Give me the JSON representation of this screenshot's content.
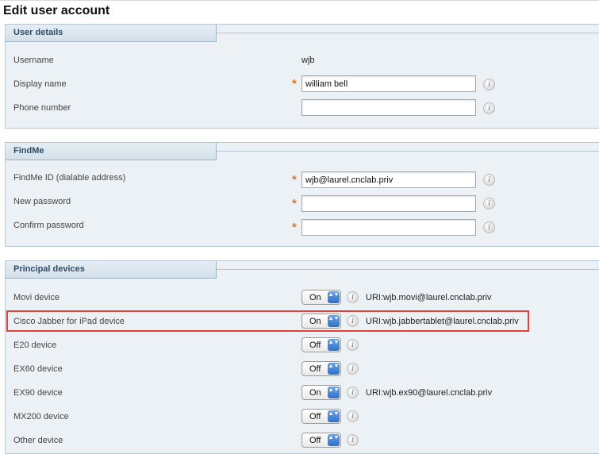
{
  "page": {
    "title": "Edit user account"
  },
  "user_details": {
    "header": "User details",
    "username_label": "Username",
    "username_value": "wjb",
    "display_name_label": "Display name",
    "display_name_value": "william bell",
    "phone_label": "Phone number",
    "phone_value": ""
  },
  "findme": {
    "header": "FindMe",
    "id_label": "FindMe ID (dialable address)",
    "id_value": "wjb@laurel.cnclab.priv",
    "new_password_label": "New password",
    "new_password_value": "",
    "confirm_password_label": "Confirm password",
    "confirm_password_value": ""
  },
  "principal_devices": {
    "header": "Principal devices",
    "devices": [
      {
        "label": "Movi device",
        "state": "On",
        "uri": "URI:wjb.movi@laurel.cnclab.priv"
      },
      {
        "label": "Cisco Jabber for iPad device",
        "state": "On",
        "uri": "URI:wjb.jabbertablet@laurel.cnclab.priv"
      },
      {
        "label": "E20 device",
        "state": "Off",
        "uri": ""
      },
      {
        "label": "EX60 device",
        "state": "Off",
        "uri": ""
      },
      {
        "label": "EX90 device",
        "state": "On",
        "uri": "URI:wjb.ex90@laurel.cnclab.priv"
      },
      {
        "label": "MX200 device",
        "state": "Off",
        "uri": ""
      },
      {
        "label": "Other device",
        "state": "Off",
        "uri": ""
      }
    ]
  },
  "common": {
    "required_mark": "*",
    "info_glyph": "i",
    "select_arrows": "▲▼"
  },
  "colors": {
    "highlight": "#e0433b",
    "required": "#e8741e",
    "section_bg": "#ecf1f5",
    "section_header_text": "#2f4d66"
  }
}
